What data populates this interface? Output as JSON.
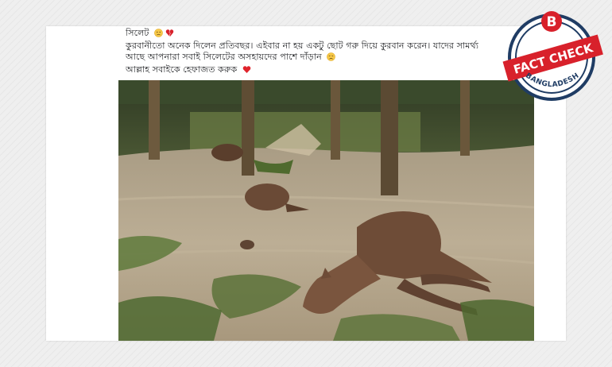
{
  "post": {
    "location": "সিলেট",
    "line1_emoji": "face-and-broken-heart-emoji",
    "line2": "কুরবানীতো অনেক দিলেন প্রতিবছর। এইবার না হয় একটু ছোট গরু দিয়ে কুরবান করেন। যাদের সামর্থ্য",
    "line3": "আছে আপনারা সবাই সিলেটের অসহায়দের পাশে দাঁড়ান",
    "line3_emoji": "sad-face-emoji",
    "line4": "আল্লাহ সবাইকে হেফাজত করুক",
    "line4_emoji": "red-heart-emoji"
  },
  "photo": {
    "subject": "flood-cattle-photo"
  },
  "badge": {
    "letter": "B",
    "main": "FACT CHECK",
    "sub": "BANGLADESH",
    "colors": {
      "red": "#d8212b",
      "navy": "#1f3c64"
    }
  }
}
